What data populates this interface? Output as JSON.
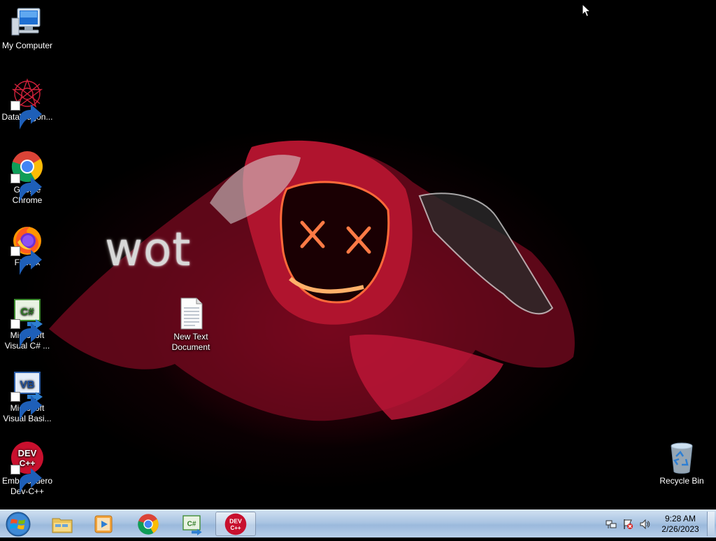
{
  "desktop": {
    "wallpaper_text": "wot",
    "icons": [
      {
        "label": "My Computer",
        "icon": "computer-icon"
      },
      {
        "label": "DataWagon...",
        "icon": "datawagon-icon"
      },
      {
        "label": "Google Chrome",
        "icon": "chrome-icon"
      },
      {
        "label": "Firefox",
        "icon": "firefox-icon"
      },
      {
        "label": "Microsoft Visual C# ...",
        "icon": "visual-csharp-icon"
      },
      {
        "label": "Microsoft Visual Basi...",
        "icon": "visual-basic-icon"
      },
      {
        "label": "Embarcadero Dev-C++",
        "icon": "devcpp-icon"
      },
      {
        "label": "New Text Document",
        "icon": "text-document-icon"
      },
      {
        "label": "Recycle Bin",
        "icon": "recycle-bin-icon"
      }
    ],
    "devcpp_badge": {
      "line1": "DEV",
      "line2": "C++"
    },
    "csharp_badge": "C#",
    "vb_badge": "VB"
  },
  "taskbar": {
    "pinned": [
      "file-explorer-icon",
      "media-player-icon",
      "chrome-icon",
      "visual-csharp-icon",
      "devcpp-icon"
    ],
    "active": "devcpp-icon"
  },
  "tray": {
    "icons": [
      "network-icon",
      "action-center-flag-icon",
      "volume-icon"
    ],
    "time": "9:28 AM",
    "date": "2/26/2023"
  },
  "colors": {
    "taskbar": "#a9c4e2",
    "devcpp_red": "#c8102e",
    "desktop_bg": "#000000"
  }
}
